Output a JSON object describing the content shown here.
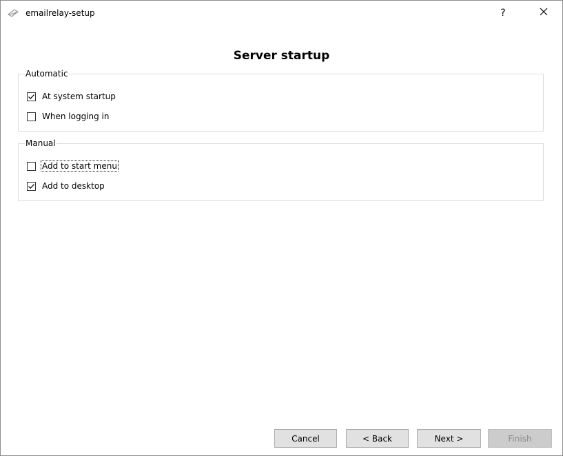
{
  "window": {
    "title": "emailrelay-setup",
    "help_glyph": "?",
    "close_glyph": "✕"
  },
  "page": {
    "heading": "Server startup"
  },
  "groups": {
    "automatic": {
      "title": "Automatic",
      "items": [
        {
          "label": "At system startup",
          "checked": true
        },
        {
          "label": "When logging in",
          "checked": false
        }
      ]
    },
    "manual": {
      "title": "Manual",
      "items": [
        {
          "label": "Add to start menu",
          "checked": false,
          "focused": true
        },
        {
          "label": "Add to desktop",
          "checked": true
        }
      ]
    }
  },
  "buttons": {
    "cancel": "Cancel",
    "back": "< Back",
    "next": "Next >",
    "finish": "Finish",
    "finish_enabled": false
  },
  "icons": {
    "app": "envelope-icon",
    "help": "help-icon",
    "close": "close-icon",
    "checkmark": "checkmark-icon"
  },
  "colors": {
    "group_border": "#dcdcdc",
    "button_face": "#e1e1e1",
    "button_disabled": "#cccccc",
    "text_disabled": "#8a8a8a"
  }
}
